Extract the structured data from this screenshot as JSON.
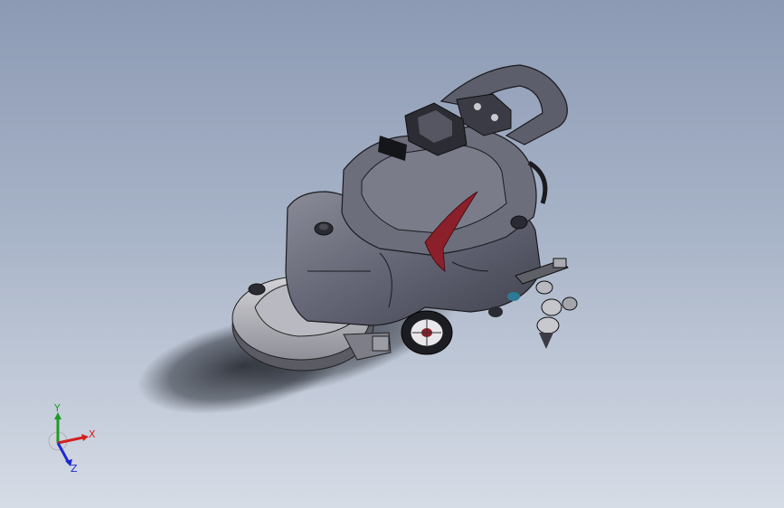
{
  "scene": {
    "model_icon": "floor-scrubber-3d-model",
    "background_colors": [
      "#8c9ab4",
      "#d6dce6"
    ],
    "body_color": "#6b6c78",
    "accent_color": "#8b1f2a"
  },
  "triad": {
    "x_label": "X",
    "y_label": "Y",
    "z_label": "Z",
    "x_color": "#d32020",
    "y_color": "#1f9a2a",
    "z_color": "#1e2ad0"
  }
}
